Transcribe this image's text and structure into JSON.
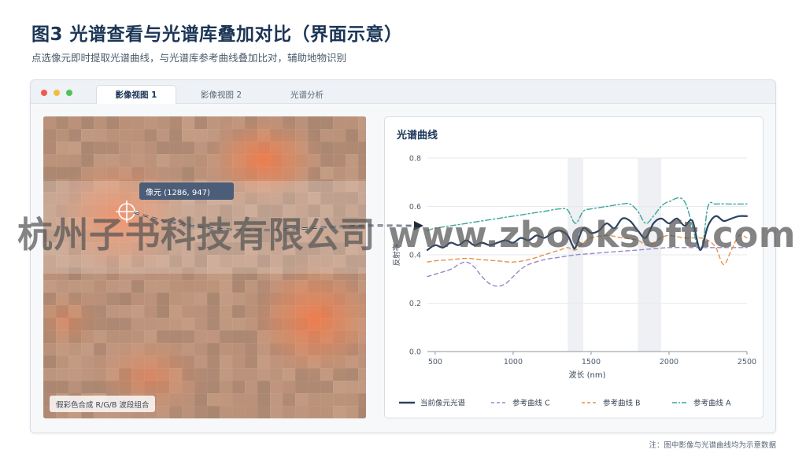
{
  "figure": {
    "title": "图3 光谱查看与光谱库叠加对比（界面示意）",
    "subtitle": "点选像元即时提取光谱曲线，与光谱库参考曲线叠加比对，辅助地物识别",
    "note": "注：图中影像与光谱曲线均为示意数据"
  },
  "window": {
    "tabs": [
      {
        "label": "影像视图 1",
        "active": true
      },
      {
        "label": "影像视图 2",
        "active": false
      },
      {
        "label": "光谱分析",
        "active": false
      }
    ]
  },
  "image_view": {
    "pixel_label": "像元 (1286, 947)",
    "caption": "假彩色合成 R/G/B 波段组合"
  },
  "watermark": "杭州子书科技有限公司 www.zbooksoft.com",
  "colors": {
    "current": "#2b4263",
    "ref_a": "#3aa796",
    "ref_b": "#e8914a",
    "ref_c": "#9a86c9",
    "title": "#1b3556"
  },
  "chart_data": {
    "type": "line",
    "title": "光谱曲线",
    "xlabel": "波长 (nm)",
    "ylabel": "反射率",
    "xlim": [
      450,
      2500
    ],
    "ylim": [
      0,
      0.8
    ],
    "xticks": [
      500,
      1000,
      1500,
      2000,
      2500
    ],
    "yticks": [
      "0.0",
      "0.2",
      "0.4",
      "0.6",
      "0.8"
    ],
    "grid": true,
    "legend_position": "bottom",
    "highlight_bands": [
      [
        1350,
        1450
      ],
      [
        1800,
        1950
      ]
    ],
    "series": [
      {
        "name": "当前像元光谱",
        "color": "#2b4263",
        "style": "solid",
        "x": [
          450,
          500,
          550,
          600,
          650,
          700,
          750,
          800,
          850,
          900,
          950,
          1000,
          1050,
          1100,
          1150,
          1200,
          1250,
          1300,
          1350,
          1380,
          1400,
          1450,
          1500,
          1550,
          1600,
          1650,
          1700,
          1750,
          1800,
          1850,
          1900,
          1950,
          2000,
          2050,
          2100,
          2150,
          2200,
          2250,
          2300,
          2350,
          2400,
          2450,
          2500
        ],
        "y": [
          0.42,
          0.44,
          0.43,
          0.45,
          0.44,
          0.46,
          0.44,
          0.45,
          0.44,
          0.45,
          0.46,
          0.45,
          0.47,
          0.46,
          0.48,
          0.47,
          0.49,
          0.5,
          0.48,
          0.44,
          0.43,
          0.51,
          0.49,
          0.5,
          0.53,
          0.51,
          0.55,
          0.54,
          0.5,
          0.47,
          0.53,
          0.55,
          0.53,
          0.55,
          0.52,
          0.54,
          0.42,
          0.52,
          0.56,
          0.54,
          0.55,
          0.56,
          0.56
        ]
      },
      {
        "name": "参考曲线 C",
        "color": "#9a86c9",
        "style": "dashed",
        "x": [
          450,
          500,
          600,
          650,
          700,
          750,
          800,
          850,
          900,
          950,
          1000,
          1050,
          1100,
          1200,
          1300,
          1400,
          1500,
          1600,
          1700,
          1800,
          1900,
          2000,
          2100,
          2200,
          2300,
          2400,
          2500
        ],
        "y": [
          0.31,
          0.32,
          0.34,
          0.36,
          0.37,
          0.35,
          0.31,
          0.28,
          0.27,
          0.28,
          0.31,
          0.34,
          0.36,
          0.38,
          0.39,
          0.4,
          0.405,
          0.41,
          0.415,
          0.42,
          0.425,
          0.43,
          0.43,
          0.43,
          0.43,
          0.43,
          0.43
        ]
      },
      {
        "name": "参考曲线 B",
        "color": "#e8914a",
        "style": "dashed",
        "x": [
          450,
          500,
          600,
          700,
          800,
          900,
          1000,
          1100,
          1200,
          1300,
          1350,
          1400,
          1450,
          1500,
          1600,
          1700,
          1800,
          1850,
          1900,
          1950,
          2000,
          2100,
          2200,
          2250,
          2300,
          2350,
          2400,
          2450,
          2500
        ],
        "y": [
          0.37,
          0.375,
          0.38,
          0.385,
          0.38,
          0.375,
          0.37,
          0.38,
          0.4,
          0.42,
          0.43,
          0.42,
          0.45,
          0.47,
          0.48,
          0.47,
          0.46,
          0.44,
          0.45,
          0.47,
          0.48,
          0.47,
          0.47,
          0.46,
          0.43,
          0.36,
          0.42,
          0.48,
          0.47
        ]
      },
      {
        "name": "参考曲线 A",
        "color": "#3aa796",
        "style": "dashdot",
        "x": [
          450,
          500,
          600,
          700,
          800,
          900,
          1000,
          1100,
          1200,
          1300,
          1350,
          1400,
          1450,
          1500,
          1600,
          1700,
          1750,
          1800,
          1850,
          1900,
          1950,
          2000,
          2100,
          2200,
          2250,
          2300,
          2400,
          2500
        ],
        "y": [
          0.5,
          0.51,
          0.52,
          0.53,
          0.54,
          0.55,
          0.56,
          0.57,
          0.58,
          0.59,
          0.585,
          0.53,
          0.58,
          0.59,
          0.6,
          0.61,
          0.61,
          0.58,
          0.53,
          0.56,
          0.6,
          0.62,
          0.62,
          0.42,
          0.6,
          0.61,
          0.61,
          0.61
        ]
      }
    ]
  }
}
